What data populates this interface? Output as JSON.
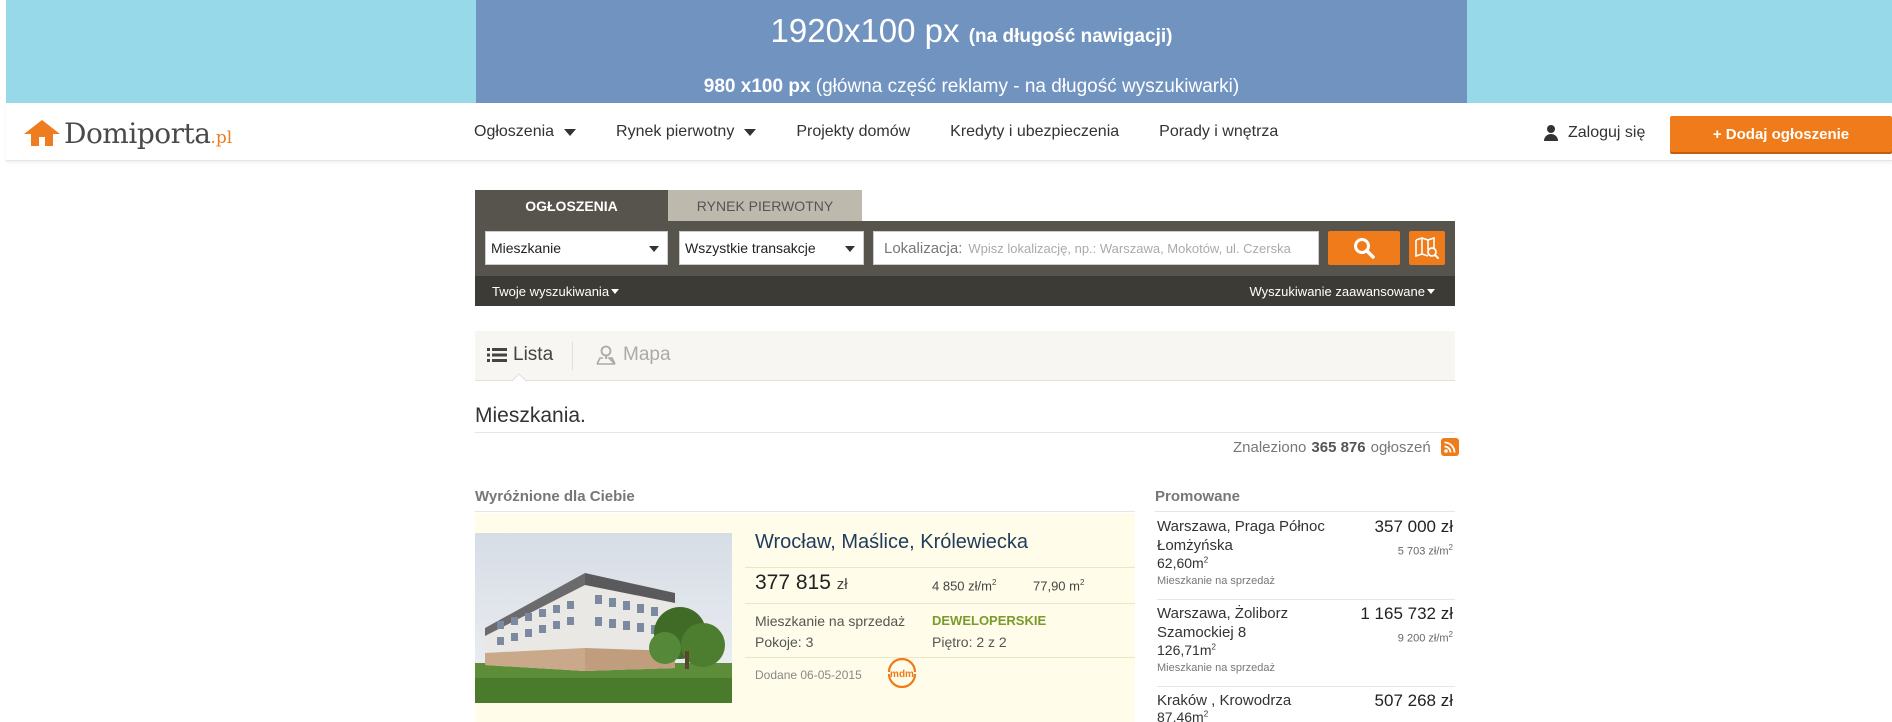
{
  "ad": {
    "line1_main": "1920x100 px",
    "line1_note": "(na długość nawigacji)",
    "line2_main": "980 x100 px",
    "line2_note": " (główna część reklamy - na długość wyszukiwarki)"
  },
  "header": {
    "logo_text": "Domiporta",
    "logo_suffix": ".pl",
    "nav": [
      {
        "label": "Ogłoszenia",
        "has_dropdown": true
      },
      {
        "label": "Rynek pierwotny",
        "has_dropdown": true
      },
      {
        "label": "Projekty domów",
        "has_dropdown": false
      },
      {
        "label": "Kredyty i ubezpieczenia",
        "has_dropdown": false
      },
      {
        "label": "Porady i wnętrza",
        "has_dropdown": false
      }
    ],
    "login_label": "Zaloguj się",
    "add_button_label": "+ Dodaj ogłoszenie"
  },
  "search": {
    "tabs": [
      {
        "label": "Ogłoszenia",
        "active": true
      },
      {
        "label": "Rynek pierwotny",
        "active": false
      }
    ],
    "property_type": "Mieszkanie",
    "transaction_type": "Wszystkie transakcje",
    "location_label": "Lokalizacja:",
    "location_placeholder": "Wpisz lokalizację, np.: Warszawa, Mokotów, ul. Czerska",
    "saved_searches_label": "Twoje wyszukiwania",
    "advanced_search_label": "Wyszukiwanie zaawansowane"
  },
  "view": {
    "list_label": "Lista",
    "map_label": "Mapa"
  },
  "results": {
    "heading": "Mieszkania.",
    "found_prefix": "Znaleziono",
    "found_count": "365 876",
    "found_suffix": "ogłoszeń"
  },
  "featured": {
    "title": "Wyróżnione dla Ciebie",
    "listing": {
      "location": "Wrocław, Maślice, Królewiecka",
      "price": "377 815",
      "currency": "zł",
      "price_per_m2": "4 850 zł/m",
      "area": "77,90 m",
      "type": "Mieszkanie na sprzedaż",
      "rooms": "Pokoje: 3",
      "market": "DEWELOPERSKIE",
      "floor": "Piętro: 2 z 2",
      "added": "Dodane 06-05-2015",
      "badge": "mdm"
    }
  },
  "promoted": {
    "title": "Promowane",
    "items": [
      {
        "location": "Warszawa, Praga Północ Łomżyńska",
        "area": "62,60m",
        "type": "Mieszkanie na sprzedaż",
        "price": "357 000 zł",
        "price_per_m2": "5 703 zł/m"
      },
      {
        "location": "Warszawa, Żoliborz Szamockiej 8",
        "area": "126,71m",
        "type": "Mieszkanie na sprzedaż",
        "price": "1 165 732 zł",
        "price_per_m2": "9 200 zł/m"
      },
      {
        "location": "Kraków , Krowodrza",
        "area": "87,46m",
        "type": "",
        "price": "507 268 zł",
        "price_per_m2": ""
      }
    ]
  },
  "colors": {
    "accent": "#ef7b1a",
    "ad_outer": "#98d9e9",
    "ad_inner": "#7193c0",
    "search_panel": "#56544c",
    "featured_bg": "#fffde9",
    "location_link": "#1f3c5e"
  }
}
